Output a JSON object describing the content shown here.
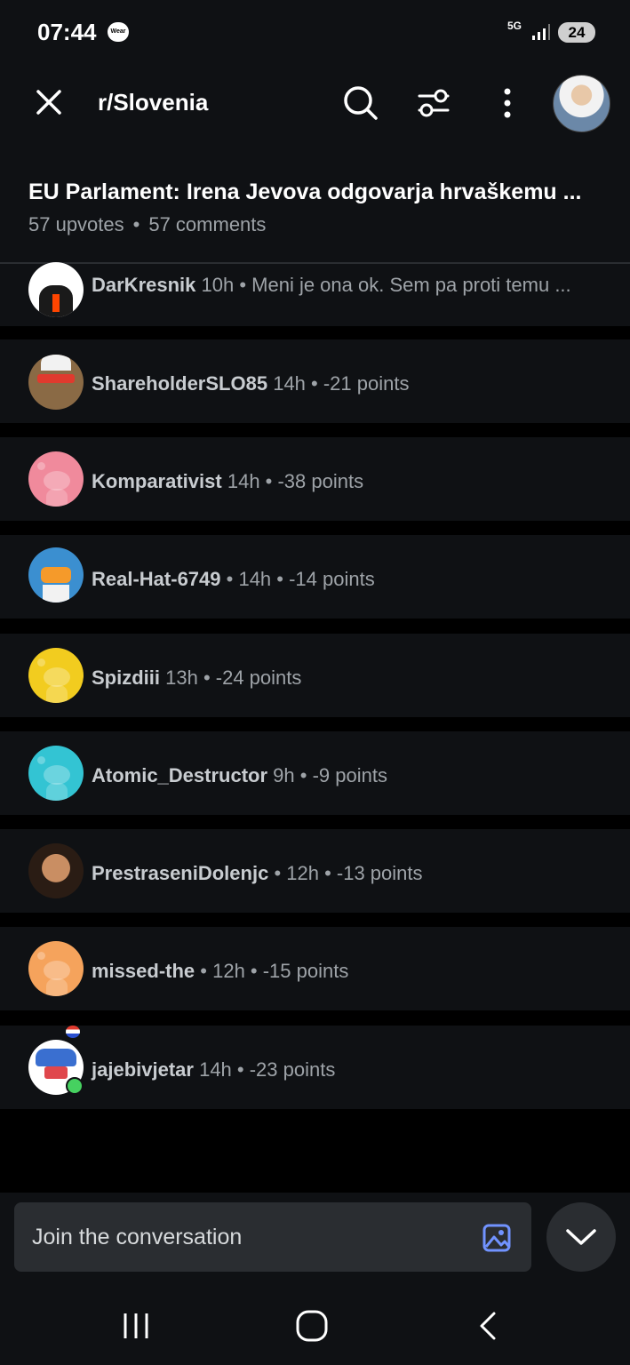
{
  "status_bar": {
    "time": "07:44",
    "wear_badge": "Wear",
    "network": "5G",
    "battery": "24"
  },
  "header": {
    "subreddit": "r/Slovenia",
    "post_title": "EU Parlament: Irena Jevova odgovarja hrvaškemu ...",
    "upvotes": "57 upvotes",
    "separator": "•",
    "comments": "57 comments"
  },
  "comments": [
    {
      "user": "DarKresnik",
      "meta": "10h • Meni je ona ok. Sem pa proti temu ...",
      "avatar_color": "#ffffff"
    },
    {
      "user": "ShareholderSLO85",
      "meta": "14h • -21 points",
      "avatar_color": "#8a6a45"
    },
    {
      "user": "Komparativist",
      "meta": "14h • -38 points",
      "avatar_color": "#f08a9c"
    },
    {
      "user": "Real-Hat-6749",
      "meta": "• 14h • -14 points",
      "avatar_color": "#3b8fd0"
    },
    {
      "user": "Spizdiii",
      "meta": "13h • -24 points",
      "avatar_color": "#f2cc1f"
    },
    {
      "user": "Atomic_Destructor",
      "meta": "9h • -9 points",
      "avatar_color": "#33c4d3"
    },
    {
      "user": "PrestraseniDolenjc",
      "meta": "• 12h • -13 points",
      "avatar_color": "#6b4a35"
    },
    {
      "user": "missed-the",
      "meta": "• 12h • -15 points",
      "avatar_color": "#f5a35c"
    },
    {
      "user": "jajebivjetar",
      "meta": "14h • -23 points",
      "avatar_color": "#3a6fd0"
    }
  ],
  "composer": {
    "placeholder": "Join the conversation"
  },
  "icons": {
    "close": "close-icon",
    "search": "search-icon",
    "filter": "filter-icon",
    "more": "more-vertical-icon",
    "image": "image-icon",
    "collapse": "chevron-down-icon",
    "recents": "recents-icon",
    "home": "home-icon",
    "back": "back-icon"
  },
  "colors": {
    "background": "#000000",
    "surface": "#0f1114",
    "accent_blue": "#7193ff",
    "online_green": "#46d160"
  }
}
